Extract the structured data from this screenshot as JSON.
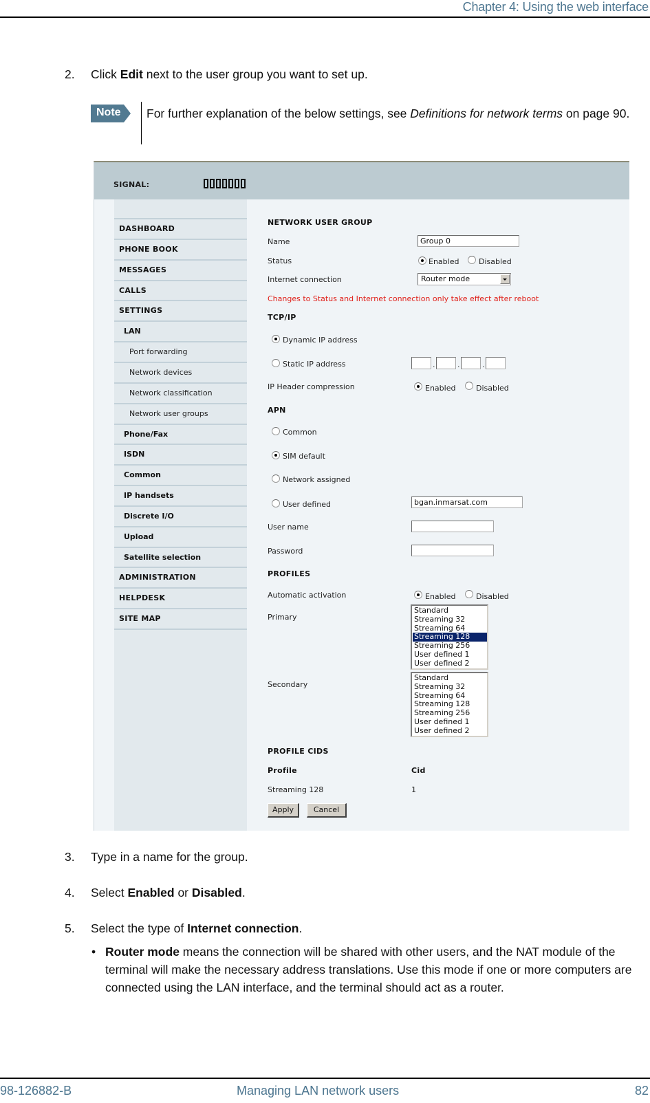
{
  "page": {
    "header_title": "Chapter 4: Using the web interface",
    "footer_left": "98-126882-B",
    "footer_center": "Managing LAN network users",
    "footer_right": "82"
  },
  "steps": {
    "step2": {
      "num": "2.",
      "pre": "Click ",
      "bold": "Edit",
      "post": " next to the user group you want to set up."
    },
    "note": {
      "badge": "Note",
      "pre": "For further explanation of the below settings, see ",
      "italic": "Definitions for network terms",
      "post": " on page 90."
    },
    "step3": {
      "num": "3.",
      "text": "Type in a name for the group."
    },
    "step4": {
      "num": "4.",
      "pre": "Select ",
      "bold1": "Enabled",
      "mid": " or ",
      "bold2": "Disabled",
      "post": "."
    },
    "step5": {
      "num": "5.",
      "pre": "Select the type of ",
      "bold": "Internet connection",
      "post": "."
    },
    "bullet1": {
      "dot": "•",
      "bold": "Router mode",
      "text": " means the connection will be shared with other users, and the NAT module of the terminal will make the necessary address translations. Use this mode if one or more computers are connected using the LAN interface, and the terminal should act as a router."
    }
  },
  "webui": {
    "signal_label": "SIGNAL:",
    "signal_bars_lit": 0,
    "signal_bars_total": 7,
    "nav": [
      {
        "label": "DASHBOARD",
        "level": 0
      },
      {
        "label": "PHONE BOOK",
        "level": 0
      },
      {
        "label": "MESSAGES",
        "level": 0
      },
      {
        "label": "CALLS",
        "level": 0
      },
      {
        "label": "SETTINGS",
        "level": 0
      },
      {
        "label": "LAN",
        "level": 1
      },
      {
        "label": "Port forwarding",
        "level": 2
      },
      {
        "label": "Network devices",
        "level": 2
      },
      {
        "label": "Network classification",
        "level": 2
      },
      {
        "label": "Network user groups",
        "level": 2
      },
      {
        "label": "Phone/Fax",
        "level": 1
      },
      {
        "label": "ISDN",
        "level": 1
      },
      {
        "label": "Common",
        "level": 1
      },
      {
        "label": "IP handsets",
        "level": 1
      },
      {
        "label": "Discrete I/O",
        "level": 1
      },
      {
        "label": "Upload",
        "level": 1
      },
      {
        "label": "Satellite selection",
        "level": 1
      },
      {
        "label": "ADMINISTRATION",
        "level": 0
      },
      {
        "label": "HELPDESK",
        "level": 0
      },
      {
        "label": "SITE MAP",
        "level": 0
      }
    ],
    "form": {
      "title": "NETWORK USER GROUP",
      "name_label": "Name",
      "name_value": "Group 0",
      "status_label": "Status",
      "enabled": "Enabled",
      "disabled": "Disabled",
      "status_value": "Enabled",
      "internet_label": "Internet connection",
      "internet_value": "Router mode",
      "warning": "Changes to Status and Internet connection only take effect after reboot",
      "tcpip_title": "TCP/IP",
      "dynamic_ip": "Dynamic IP address",
      "static_ip": "Static IP address",
      "ip_mode_value": "Dynamic IP address",
      "ip_octets": [
        "",
        "",
        "",
        ""
      ],
      "ip_sep": ".",
      "ip_header_label": "IP Header compression",
      "ip_header_value": "Enabled",
      "apn_title": "APN",
      "apn_common": "Common",
      "apn_sim": "SIM default",
      "apn_network": "Network assigned",
      "apn_user": "User defined",
      "apn_value": "SIM default",
      "apn_user_value": "bgan.inmarsat.com",
      "username_label": "User name",
      "username_value": "",
      "password_label": "Password",
      "password_value": "",
      "profiles_title": "PROFILES",
      "auto_label": "Automatic activation",
      "auto_value": "Enabled",
      "primary_label": "Primary",
      "secondary_label": "Secondary",
      "profile_options": [
        "Standard",
        "Streaming 32",
        "Streaming 64",
        "Streaming 128",
        "Streaming 256",
        "User defined 1",
        "User defined 2"
      ],
      "primary_selected": "Streaming 128",
      "secondary_selected": "",
      "cids_title": "PROFILE CIDS",
      "cids_col_profile": "Profile",
      "cids_col_cid": "Cid",
      "cids_rows": [
        {
          "profile": "Streaming 128",
          "cid": "1"
        }
      ],
      "apply": "Apply",
      "cancel": "Cancel"
    }
  },
  "colors": {
    "header_text": "#4d7690",
    "note_badge": "#527a91",
    "ui_header": "#bccbd1",
    "ui_sidebar": "#e2e9ed",
    "ui_content": "#f0f4f7",
    "warning": "#e0201a",
    "selection": "#0a246a"
  }
}
